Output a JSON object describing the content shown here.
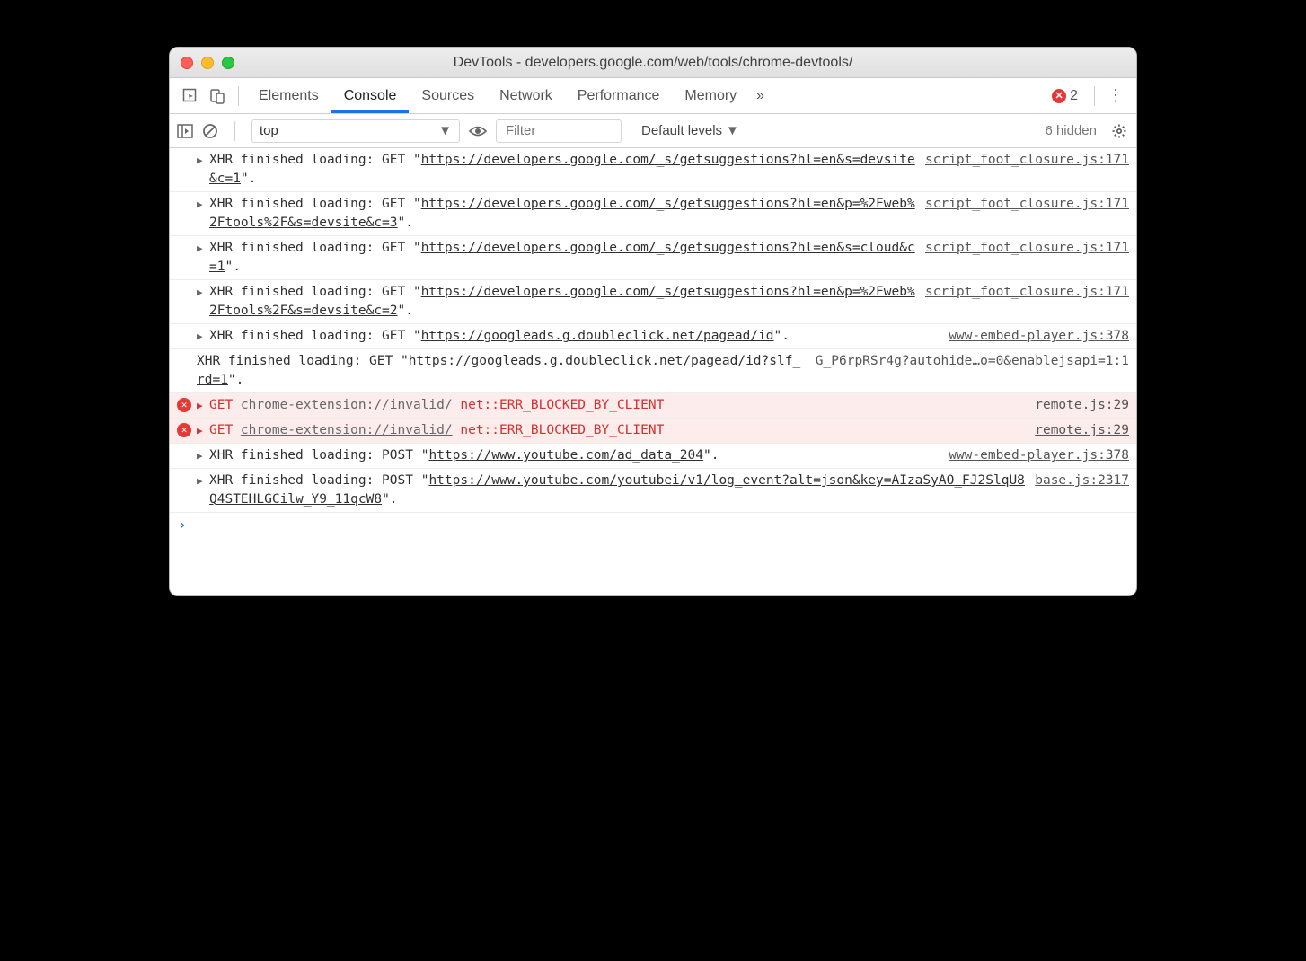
{
  "window": {
    "title": "DevTools - developers.google.com/web/tools/chrome-devtools/"
  },
  "tabs": {
    "items": [
      "Elements",
      "Console",
      "Sources",
      "Network",
      "Performance",
      "Memory"
    ],
    "active": "Console",
    "more": "»",
    "error_count": "2"
  },
  "toolbar": {
    "context": "top",
    "filter_placeholder": "Filter",
    "levels": "Default levels",
    "hidden": "6 hidden"
  },
  "log": [
    {
      "type": "xhr",
      "prefix": "XHR finished loading: GET \"",
      "url": "https://developers.google.com/_s/getsuggestions?hl=en&s=devsite&c=1",
      "suffix": "\".",
      "src": "script_foot_closure.js:171",
      "disclose": true
    },
    {
      "type": "xhr",
      "prefix": "XHR finished loading: GET \"",
      "url": "https://developers.google.com/_s/getsuggestions?hl=en&p=%2Fweb%2Ftools%2F&s=devsite&c=3",
      "suffix": "\".",
      "src": "script_foot_closure.js:171",
      "disclose": true
    },
    {
      "type": "xhr",
      "prefix": "XHR finished loading: GET \"",
      "url": "https://developers.google.com/_s/getsuggestions?hl=en&s=cloud&c=1",
      "suffix": "\".",
      "src": "script_foot_closure.js:171",
      "disclose": true
    },
    {
      "type": "xhr",
      "prefix": "XHR finished loading: GET \"",
      "url": "https://developers.google.com/_s/getsuggestions?hl=en&p=%2Fweb%2Ftools%2F&s=devsite&c=2",
      "suffix": "\".",
      "src": "script_foot_closure.js:171",
      "disclose": true
    },
    {
      "type": "xhr",
      "prefix": "XHR finished loading: GET \"",
      "url": "https://googleads.g.doubleclick.net/pagead/id",
      "suffix": "\".",
      "src": "www-embed-player.js:378",
      "disclose": true
    },
    {
      "type": "xhr",
      "prefix": "XHR finished loading: GET \"",
      "url": "https://googleads.g.doubleclick.net/pagead/id?slf_rd=1",
      "suffix": "\".",
      "src": "G_P6rpRSr4g?autohide…o=0&enablejsapi=1:1",
      "disclose": false
    },
    {
      "type": "error",
      "method": "GET",
      "url": "chrome-extension://invalid/",
      "err": "net::ERR_BLOCKED_BY_CLIENT",
      "src": "remote.js:29",
      "disclose": true
    },
    {
      "type": "error",
      "method": "GET",
      "url": "chrome-extension://invalid/",
      "err": "net::ERR_BLOCKED_BY_CLIENT",
      "src": "remote.js:29",
      "disclose": true
    },
    {
      "type": "xhr",
      "prefix": "XHR finished loading: POST \"",
      "url": "https://www.youtube.com/ad_data_204",
      "suffix": "\".",
      "src": "www-embed-player.js:378",
      "disclose": true
    },
    {
      "type": "xhr",
      "prefix": "XHR finished loading: POST \"",
      "url": "https://www.youtube.com/youtubei/v1/log_event?alt=json&key=AIzaSyAO_FJ2SlqU8Q4STEHLGCilw_Y9_11qcW8",
      "suffix": "\".",
      "src": "base.js:2317",
      "disclose": true
    }
  ],
  "prompt": "›"
}
